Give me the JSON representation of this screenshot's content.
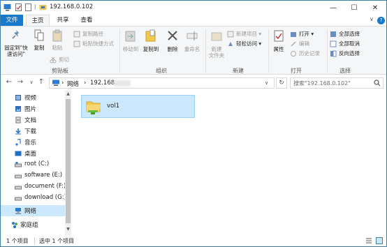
{
  "window": {
    "title": "192.168.0.102",
    "minimize": "—",
    "maximize": "☐",
    "close": "✕",
    "qat_separator": "|"
  },
  "tabs": {
    "file": "文件",
    "home": "主页",
    "share": "共享",
    "view": "查看",
    "collapse_ribbon": "∨",
    "help": "?"
  },
  "ribbon": {
    "clipboard": {
      "group_label": "剪贴板",
      "pin_quick_access": "固定到\"快\n速访问\"",
      "copy": "复制",
      "paste": "粘贴",
      "cut": "剪切",
      "copy_path": "复制路径",
      "paste_shortcut": "粘贴快捷方式"
    },
    "organize": {
      "group_label": "组织",
      "move_to": "移动到",
      "copy_to": "复制到",
      "delete": "删除",
      "rename": "重命名"
    },
    "new": {
      "group_label": "新建",
      "new_folder": "新建\n文件夹",
      "new_item": "新建项目 ▾",
      "easy_access": "轻松访问 ▾"
    },
    "open": {
      "group_label": "打开",
      "properties": "属性",
      "open": "打开 ▾",
      "edit": "编辑",
      "history": "历史记录"
    },
    "select": {
      "group_label": "选择",
      "select_all": "全部选择",
      "select_none": "全部取消",
      "invert_selection": "反向选择"
    }
  },
  "address": {
    "back": "←",
    "forward": "→",
    "recent": "∨",
    "up": "↑",
    "crumb_sep": "›",
    "network": "网络",
    "host_partial": "192.168.",
    "dropdown": "∨",
    "refresh": "↻",
    "search_placeholder": "搜索\"192.168.0.102\""
  },
  "nav_pane": {
    "items": [
      {
        "label": "视频",
        "icon": "video-icon"
      },
      {
        "label": "图片",
        "icon": "pictures-icon"
      },
      {
        "label": "文档",
        "icon": "documents-icon"
      },
      {
        "label": "下载",
        "icon": "downloads-icon"
      },
      {
        "label": "音乐",
        "icon": "music-icon"
      },
      {
        "label": "桌面",
        "icon": "desktop-icon"
      },
      {
        "label": "root (C:)",
        "icon": "drive-icon"
      },
      {
        "label": "software (E:)",
        "icon": "drive-icon"
      },
      {
        "label": "document (F:)",
        "icon": "drive-icon"
      },
      {
        "label": "download (G:)",
        "icon": "drive-icon"
      },
      {
        "label": "网络",
        "icon": "network-icon",
        "selected": true
      },
      {
        "label": "家庭组",
        "icon": "homegroup-icon"
      }
    ],
    "scroll_up": "▲",
    "scroll_down": "▼"
  },
  "content": {
    "items": [
      {
        "name": "vol1",
        "icon": "shared-folder-icon",
        "selected": true
      }
    ]
  },
  "status": {
    "count": "1 个项目",
    "selected": "选中 1 个项目"
  },
  "colors": {
    "accent": "#1979ca",
    "selection": "#cce8ff",
    "selection_border": "#99d1ff"
  }
}
